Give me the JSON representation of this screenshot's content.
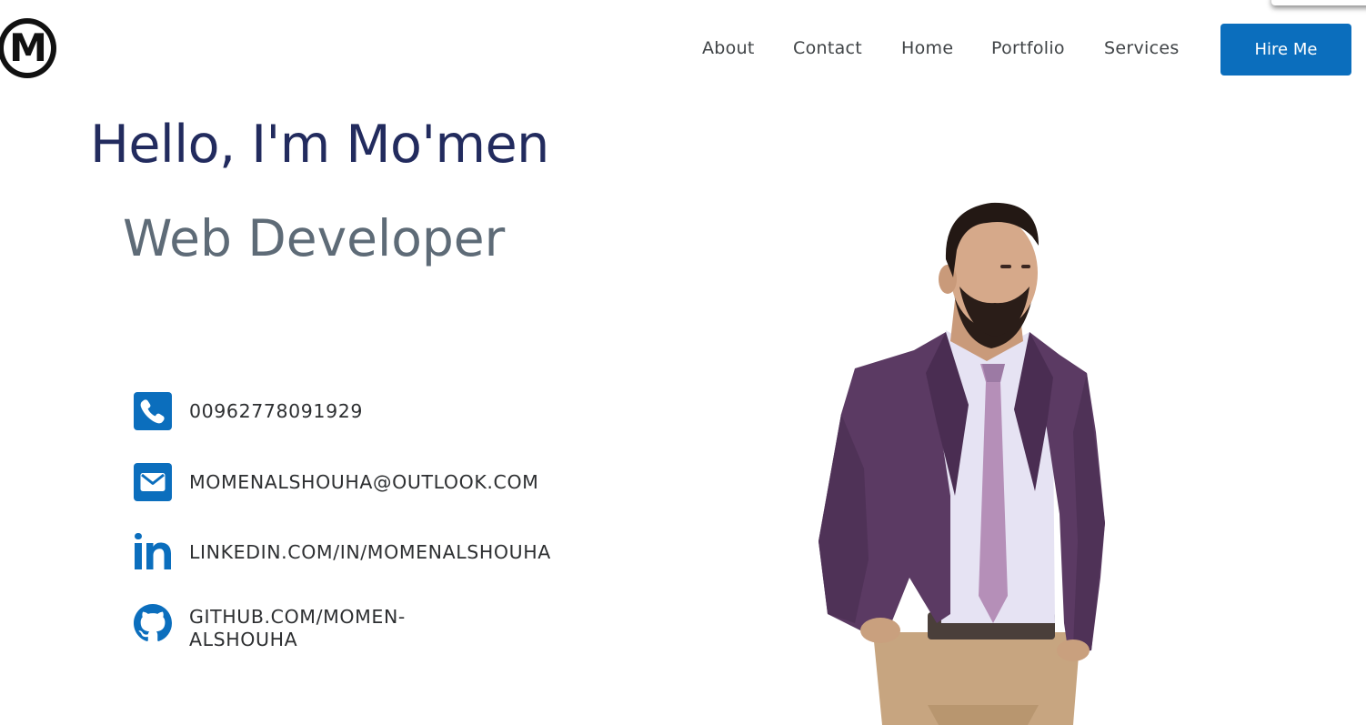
{
  "logo": {
    "letter": "M"
  },
  "nav": {
    "links": [
      "About",
      "Contact",
      "Home",
      "Portfolio",
      "Services"
    ],
    "cta": "Hire Me"
  },
  "hero": {
    "greeting": "Hello, I'm Mo'men",
    "role": "Web Developer"
  },
  "contacts": [
    {
      "icon": "phone-icon",
      "text": "00962778091929"
    },
    {
      "icon": "envelope-icon",
      "text": "MOMENALSHOUHA@OUTLOOK.COM"
    },
    {
      "icon": "linkedin-icon",
      "text": "LINKEDIN.COM/IN/MOMENALSHOUHA"
    },
    {
      "icon": "github-icon",
      "text": "GITHUB.COM/MOMEN-ALSHOUHA"
    }
  ],
  "colors": {
    "accent": "#0b6ebd",
    "heading": "#222b5e",
    "subheading": "#5e6b77",
    "text": "#2d2f31"
  }
}
